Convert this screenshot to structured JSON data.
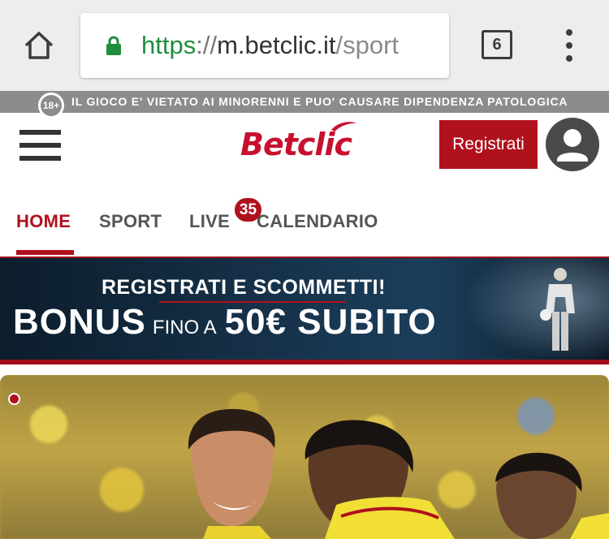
{
  "browser": {
    "url_scheme": "https",
    "url_separator": "://",
    "url_host": "m.betclic.it",
    "url_path": "/sport",
    "tab_count": "6",
    "icons": {
      "home": "home-icon",
      "lock": "lock-icon",
      "tabs": "tab-switcher-icon",
      "menu": "more-vert-icon"
    },
    "scheme_color": "#1e8e3e"
  },
  "warning": {
    "age_badge": "18+",
    "text": "IL GIOCO E' VIETATO AI MINORENNI E PUO' CAUSARE DIPENDENZA PATOLOGICA"
  },
  "header": {
    "logo_text": "Betclic",
    "register_label": "Registrati",
    "icons": {
      "menu": "hamburger-menu-icon",
      "account": "user-account-icon"
    },
    "brand_color": "#b0111d"
  },
  "nav": {
    "tabs": [
      {
        "label": "HOME",
        "active": true
      },
      {
        "label": "SPORT",
        "active": false
      },
      {
        "label": "LIVE",
        "active": false,
        "badge": "35"
      },
      {
        "label": "CALENDARIO",
        "active": false
      }
    ]
  },
  "banner": {
    "line1": "REGISTRATI E SCOMMETTI!",
    "bonus": "BONUS",
    "fino": "FINO A",
    "amount": "50€ SUBITO"
  },
  "hero": {
    "image": "football-players-celebrating-photo"
  }
}
